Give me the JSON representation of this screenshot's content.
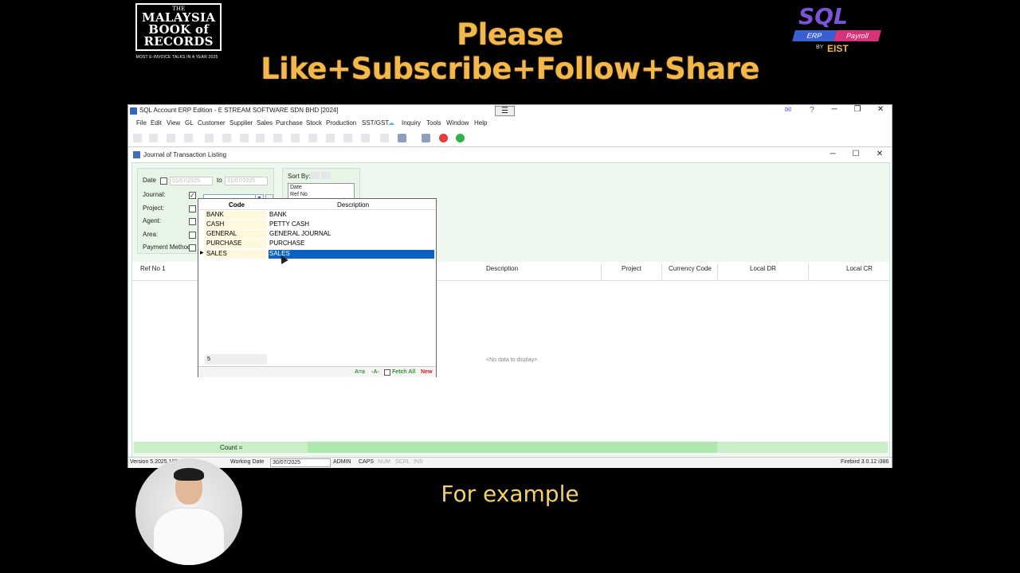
{
  "banner": {
    "record_logo_small": "THE",
    "record_logo_title": "MALAYSIA BOOK of RECORDS",
    "record_logo_sub": "MOST E-INVOICE TALKS IN A YEAR 2025",
    "headline": "Please Like+Subscribe+Follow+Share",
    "sql_word": "SQL",
    "sql_erp": "ERP",
    "sql_payroll": "Payroll",
    "sql_by": "BY",
    "sql_eist": "EIST"
  },
  "app": {
    "title": "SQL Account ERP Edition - E STREAM SOFTWARE SDN BHD [2024]",
    "menu_button": "☰",
    "menu": [
      "File",
      "Edit",
      "View",
      "GL",
      "Customer",
      "Supplier",
      "Sales",
      "Purchase",
      "Stock",
      "Production",
      "SST/GST",
      "Inquiry",
      "Tools",
      "Window",
      "Help"
    ],
    "window_controls": {
      "minimize": "─",
      "restore": "❐",
      "close": "✕"
    }
  },
  "child": {
    "title": "Journal of Transaction Listing",
    "filters": {
      "date_label": "Date",
      "date_from": "01/07/2025",
      "to_label": "to",
      "date_to": "31/07/2025",
      "journal_label": "Journal:",
      "project_label": "Project:",
      "agent_label": "Agent:",
      "area_label": "Area:",
      "payment_method_label": "Payment Method"
    },
    "sort": {
      "label": "Sort By:",
      "items": [
        "Date",
        "Ref No"
      ]
    },
    "grid_columns": [
      "Ref No 1",
      "Description",
      "Project",
      "Currency Code",
      "Local DR",
      "Local CR"
    ],
    "no_data": "<No data to display>",
    "count_label": "Count ="
  },
  "dropdown": {
    "columns": [
      "Code",
      "Description"
    ],
    "rows": [
      {
        "code": "BANK",
        "desc": "BANK"
      },
      {
        "code": "CASH",
        "desc": "PETTY CASH"
      },
      {
        "code": "GENERAL",
        "desc": "GENERAL JOURNAL"
      },
      {
        "code": "PURCHASE",
        "desc": "PURCHASE"
      },
      {
        "code": "SALES",
        "desc": "SALES"
      }
    ],
    "selected_index": 4,
    "count": "5",
    "footer": {
      "aa": "A=a",
      "a": "-A-",
      "fetch_all": "Fetch All",
      "new": "New"
    }
  },
  "statusbar": {
    "version": "Version 5.2025.102...",
    "working_date_label": "Working Date",
    "working_date": "30/07/2025",
    "user": "ADMIN",
    "caps": "CAPS",
    "num": "NUM",
    "scrl": "SCRL",
    "ins": "INS",
    "db": "Firebird 3.0.12 i386"
  },
  "caption": "For example",
  "colors": {
    "accent_blue": "#0b62c4",
    "panel_green": "#eef8ee",
    "headline_gold": "#f2b84b",
    "new_red": "#d0201a",
    "fetch_green": "#2a9d2a"
  }
}
